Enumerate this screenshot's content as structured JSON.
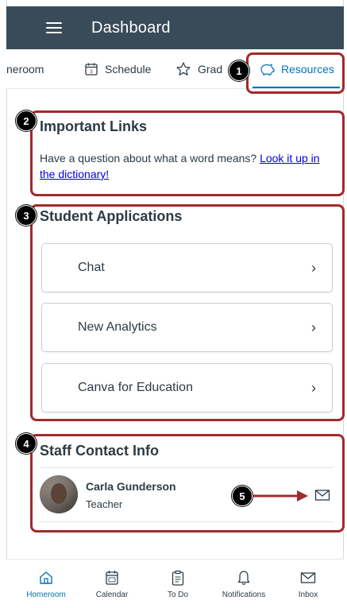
{
  "header": {
    "title": "Dashboard"
  },
  "tabs": [
    {
      "label": "neroom",
      "icon": "home-icon"
    },
    {
      "label": "Schedule",
      "icon": "calendar-icon"
    },
    {
      "label": "Grad",
      "icon": "star-icon"
    },
    {
      "label": "Resources",
      "icon": "piggy-bank-icon",
      "active": true
    }
  ],
  "callouts": [
    "1",
    "2",
    "3",
    "4",
    "5"
  ],
  "important_links": {
    "title": "Important Links",
    "text": "Have a question about what a word means?",
    "link": "Look it up in the dictionary!"
  },
  "student_apps": {
    "title": "Student Applications",
    "items": [
      "Chat",
      "New Analytics",
      "Canva for Education"
    ]
  },
  "staff": {
    "title": "Staff Contact Info",
    "name": "Carla Gunderson",
    "role": "Teacher"
  },
  "bottom_nav": [
    {
      "label": "Homeroom",
      "active": true
    },
    {
      "label": "Calendar"
    },
    {
      "label": "To Do"
    },
    {
      "label": "Notifications"
    },
    {
      "label": "Inbox"
    }
  ],
  "colors": {
    "appbar": "#394b58",
    "accent": "#0374b5",
    "callout": "#a12a2c",
    "link": "#0000ee"
  }
}
